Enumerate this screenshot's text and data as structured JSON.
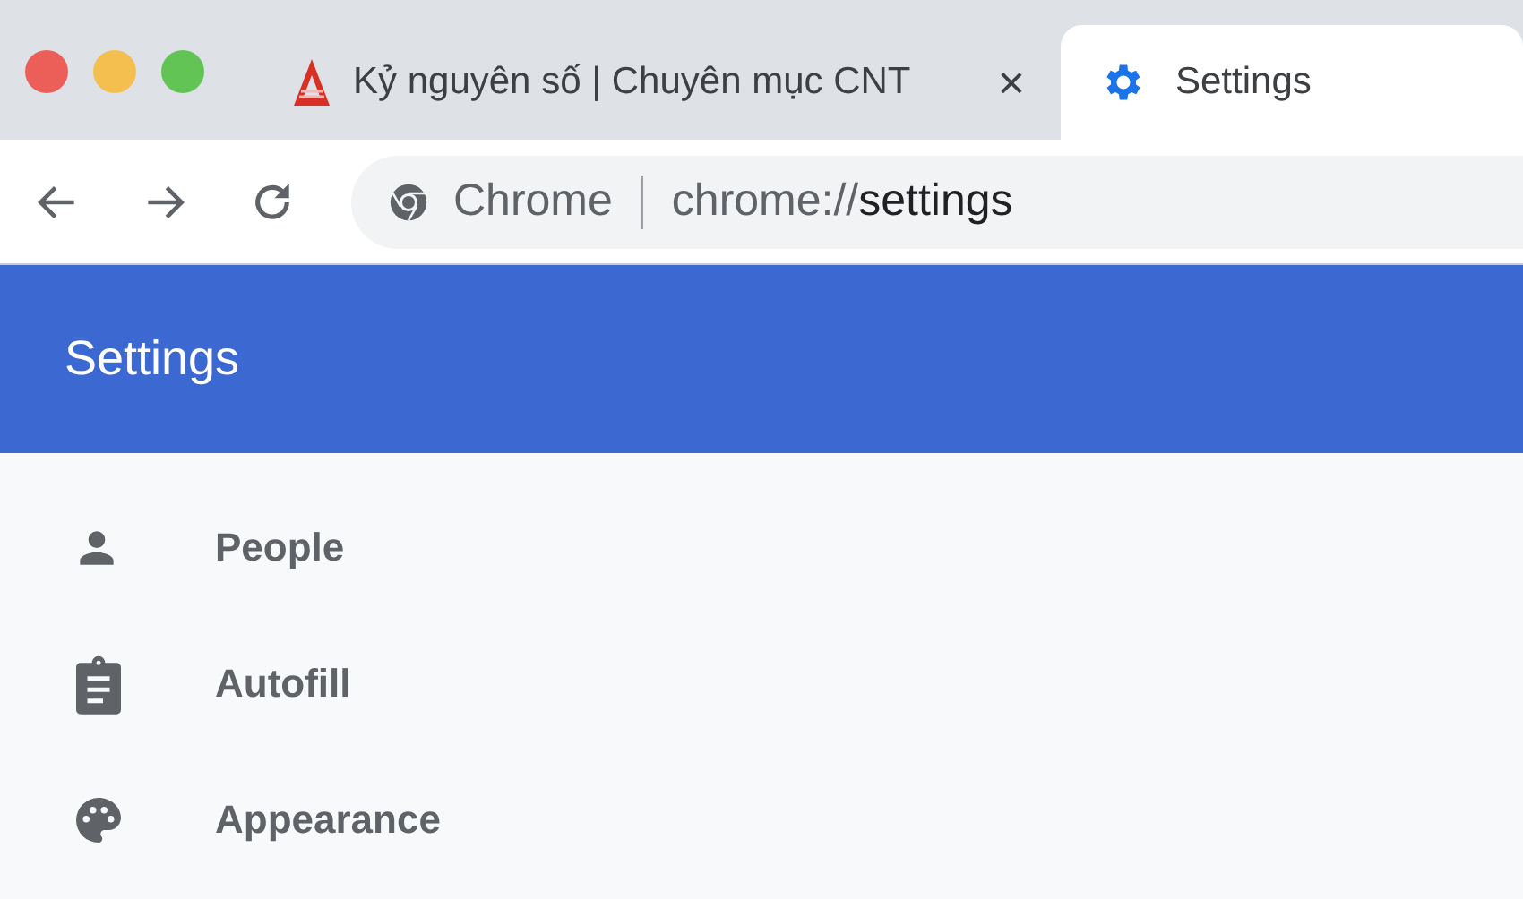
{
  "tabs": [
    {
      "title": "Kỷ nguyên số | Chuyên mục CNT",
      "kind": "logo",
      "close": "×",
      "selected": false
    },
    {
      "title": "Settings",
      "kind": "gear",
      "selected": true
    }
  ],
  "omnibox": {
    "site_label": "Chrome",
    "url_scheme": "chrome://",
    "url_path": "settings"
  },
  "header": {
    "title": "Settings"
  },
  "menu": [
    {
      "label": "People",
      "kind": "person"
    },
    {
      "label": "Autofill",
      "kind": "clipboard"
    },
    {
      "label": "Appearance",
      "kind": "palette"
    }
  ]
}
